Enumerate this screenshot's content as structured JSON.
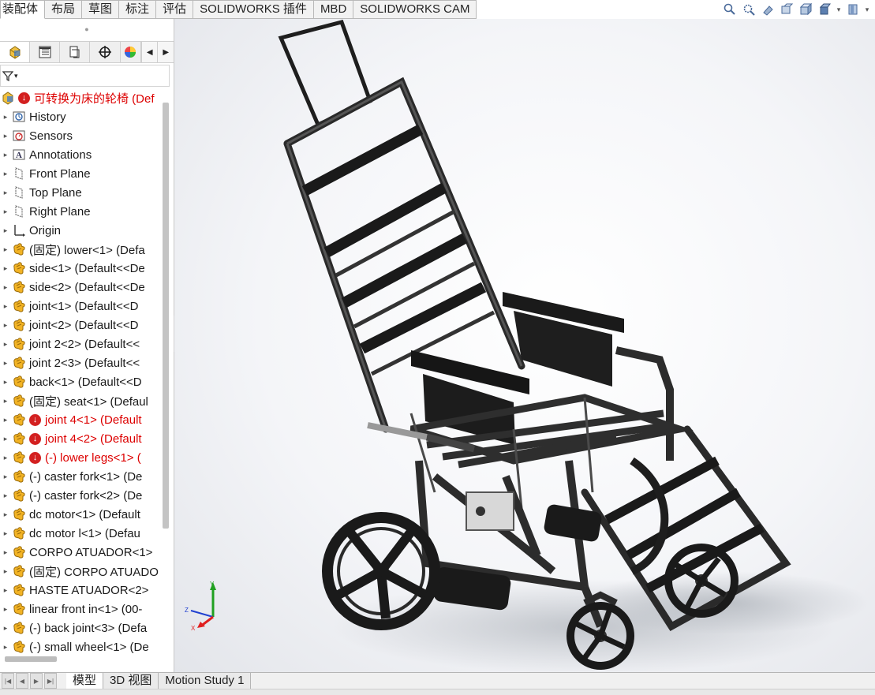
{
  "command_tabs": [
    "装配体",
    "布局",
    "草图",
    "标注",
    "评估",
    "SOLIDWORKS 插件",
    "MBD",
    "SOLIDWORKS CAM"
  ],
  "active_command_tab": "装配体",
  "view_tools": [
    "zoom-to-fit-icon",
    "zoom-area-icon",
    "previous-view-icon",
    "section-view-icon",
    "view-orientation-icon",
    "display-style-icon",
    "view-settings-icon"
  ],
  "manager_tabs": [
    "featuremanager-icon",
    "propertymanager-icon",
    "configurationmanager-icon",
    "dimxpert-icon",
    "display-manager-icon"
  ],
  "tree": {
    "root": "可转换为床的轮椅 (Def",
    "items": [
      {
        "label": "History",
        "icon": "history-icon",
        "red": false,
        "warn": false
      },
      {
        "label": "Sensors",
        "icon": "sensors-icon",
        "red": false,
        "warn": false
      },
      {
        "label": "Annotations",
        "icon": "annotations-icon",
        "red": false,
        "warn": false
      },
      {
        "label": "Front Plane",
        "icon": "plane-icon",
        "red": false,
        "warn": false
      },
      {
        "label": "Top Plane",
        "icon": "plane-icon",
        "red": false,
        "warn": false
      },
      {
        "label": "Right Plane",
        "icon": "plane-icon",
        "red": false,
        "warn": false
      },
      {
        "label": "Origin",
        "icon": "origin-icon",
        "red": false,
        "warn": false
      },
      {
        "label": "(固定) lower<1> (Defa",
        "icon": "part-icon",
        "red": false,
        "warn": false
      },
      {
        "label": "side<1> (Default<<De",
        "icon": "part-icon",
        "red": false,
        "warn": false
      },
      {
        "label": "side<2> (Default<<De",
        "icon": "part-icon",
        "red": false,
        "warn": false
      },
      {
        "label": "joint<1> (Default<<D",
        "icon": "part-icon",
        "red": false,
        "warn": false
      },
      {
        "label": "joint<2> (Default<<D",
        "icon": "part-icon",
        "red": false,
        "warn": false
      },
      {
        "label": "joint 2<2> (Default<<",
        "icon": "part-icon",
        "red": false,
        "warn": false
      },
      {
        "label": "joint 2<3> (Default<<",
        "icon": "part-icon",
        "red": false,
        "warn": false
      },
      {
        "label": "back<1> (Default<<D",
        "icon": "part-icon",
        "red": false,
        "warn": false
      },
      {
        "label": "(固定) seat<1> (Defaul",
        "icon": "part-icon",
        "red": false,
        "warn": false
      },
      {
        "label": "joint 4<1> (Default",
        "icon": "part-icon",
        "red": true,
        "warn": true
      },
      {
        "label": "joint 4<2> (Default",
        "icon": "part-icon",
        "red": true,
        "warn": true
      },
      {
        "label": "(-) lower legs<1> (",
        "icon": "part-icon",
        "red": true,
        "warn": true
      },
      {
        "label": "(-) caster fork<1> (De",
        "icon": "part-icon",
        "red": false,
        "warn": false
      },
      {
        "label": "(-) caster fork<2> (De",
        "icon": "part-icon",
        "red": false,
        "warn": false
      },
      {
        "label": "dc motor<1> (Default",
        "icon": "part-icon",
        "red": false,
        "warn": false
      },
      {
        "label": "dc motor l<1> (Defau",
        "icon": "part-icon",
        "red": false,
        "warn": false
      },
      {
        "label": "CORPO ATUADOR<1>",
        "icon": "part-icon",
        "red": false,
        "warn": false
      },
      {
        "label": "(固定) CORPO ATUADO",
        "icon": "part-icon",
        "red": false,
        "warn": false
      },
      {
        "label": "HASTE ATUADOR<2>",
        "icon": "part-icon",
        "red": false,
        "warn": false
      },
      {
        "label": "linear front in<1> (00-",
        "icon": "part-icon",
        "red": false,
        "warn": false
      },
      {
        "label": "(-) back joint<3> (Defa",
        "icon": "part-icon",
        "red": false,
        "warn": false
      },
      {
        "label": "(-) small wheel<1> (De",
        "icon": "part-icon",
        "red": false,
        "warn": false
      }
    ]
  },
  "bottom_tabs": [
    "模型",
    "3D 视图",
    "Motion Study 1"
  ],
  "active_bottom_tab": "模型",
  "triad": {
    "x": "X",
    "y": "Y",
    "z": "Z"
  },
  "colors": {
    "warning": "#d32020",
    "error_text": "#dd0000",
    "part_icon": "#e8b32a",
    "axis_x": "#e02020",
    "axis_y": "#20a020",
    "axis_z": "#2040d0"
  }
}
